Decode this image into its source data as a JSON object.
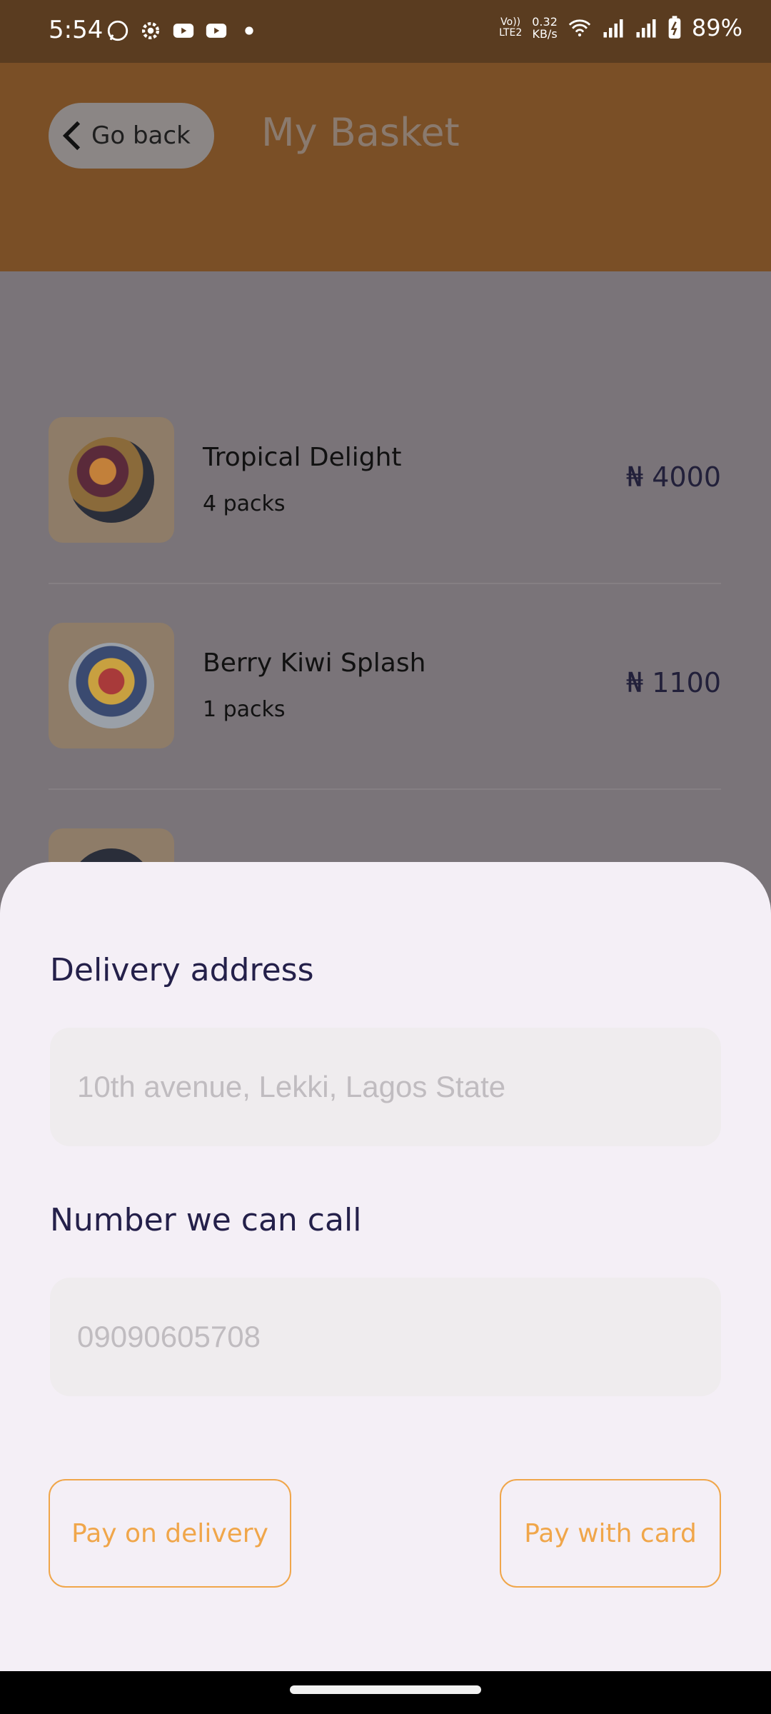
{
  "status_bar": {
    "time": "5:54",
    "network_speed": "0.32\nKB/s",
    "volte": "VoLTE2",
    "battery": "89%"
  },
  "header": {
    "back_label": "Go back",
    "title": "My Basket"
  },
  "currency_symbol": "₦",
  "basket": {
    "items": [
      {
        "name": "Tropical Delight",
        "qty": "4 packs",
        "price": "₦ 4000"
      },
      {
        "name": "Berry Kiwi Splash",
        "qty": "1 packs",
        "price": "₦ 1100"
      }
    ]
  },
  "sheet": {
    "address_label": "Delivery address",
    "address_placeholder": "10th avenue, Lekki, Lagos State",
    "phone_label": "Number we can call",
    "phone_placeholder": "09090605708",
    "pay_delivery_label": "Pay on delivery",
    "pay_card_label": "Pay with card"
  },
  "colors": {
    "accent": "#f0a64a",
    "header": "#7a4f26",
    "overlay": "#7a7479",
    "sheet": "#f4eff6"
  }
}
